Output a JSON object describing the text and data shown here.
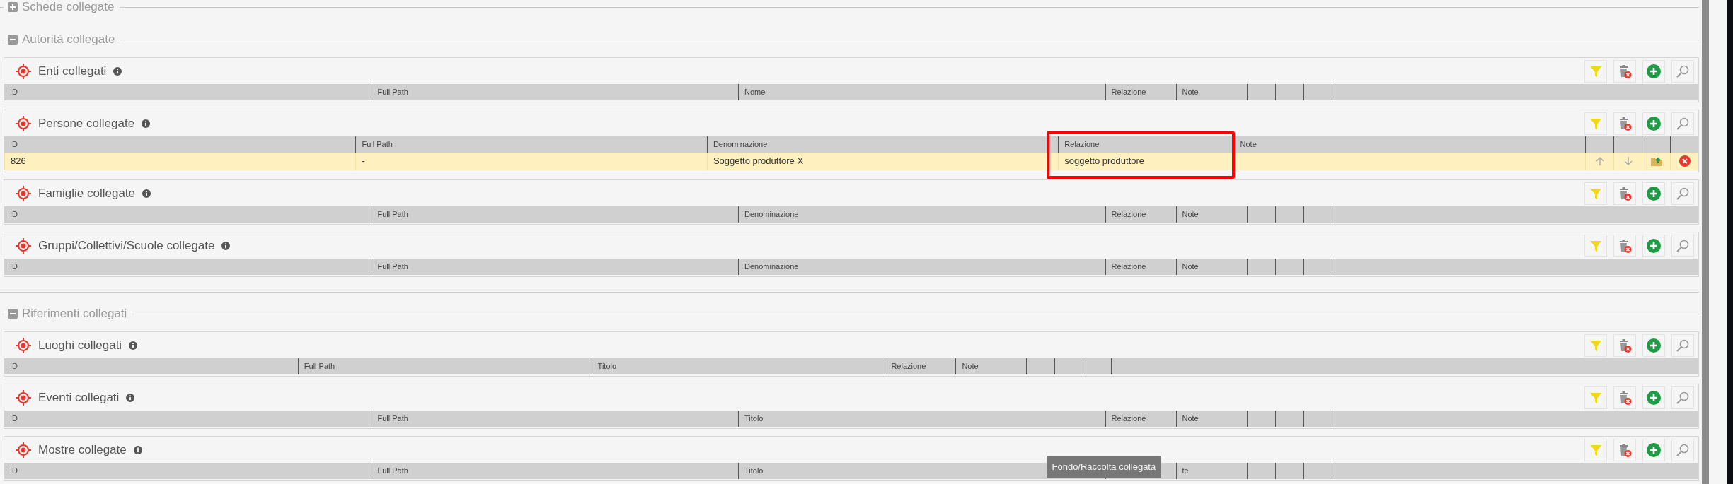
{
  "sections": [
    {
      "title": "Schede collegate",
      "expanded": false
    },
    {
      "title": "Autorità collegate",
      "expanded": true,
      "panels": [
        {
          "title": "Enti collegati",
          "columns": [
            {
              "label": "ID",
              "kind": "wide"
            },
            {
              "label": "Full Path",
              "kind": "wide"
            },
            {
              "label": "Nome",
              "kind": "wide"
            },
            {
              "label": "Relazione",
              "kind": "short"
            },
            {
              "label": "Note",
              "kind": "short"
            },
            {
              "kind": "action"
            },
            {
              "kind": "action"
            },
            {
              "kind": "action"
            },
            {
              "kind": "filler"
            }
          ]
        },
        {
          "title": "Persone collegate",
          "columns": [
            {
              "label": "ID",
              "kind": "wide"
            },
            {
              "label": "Full Path",
              "kind": "wide"
            },
            {
              "label": "Denominazione",
              "kind": "wide"
            },
            {
              "label": "Relazione",
              "kind": "medium",
              "highlighted": true
            },
            {
              "label": "Note",
              "kind": "wide"
            },
            {
              "kind": "action"
            },
            {
              "kind": "action"
            },
            {
              "kind": "action"
            },
            {
              "kind": "action"
            }
          ],
          "rows": [
            {
              "selected": true,
              "cells": [
                "826",
                "-",
                "Soggetto produttore X",
                "soggetto produttore"
              ]
            }
          ]
        },
        {
          "title": "Famiglie collegate",
          "columns": [
            {
              "label": "ID",
              "kind": "wide"
            },
            {
              "label": "Full Path",
              "kind": "wide"
            },
            {
              "label": "Denominazione",
              "kind": "wide"
            },
            {
              "label": "Relazione",
              "kind": "short"
            },
            {
              "label": "Note",
              "kind": "short"
            },
            {
              "kind": "action"
            },
            {
              "kind": "action"
            },
            {
              "kind": "action"
            },
            {
              "kind": "filler"
            }
          ]
        },
        {
          "title": "Gruppi/Collettivi/Scuole collegate",
          "columns": [
            {
              "label": "ID",
              "kind": "wide"
            },
            {
              "label": "Full Path",
              "kind": "wide"
            },
            {
              "label": "Denominazione",
              "kind": "wide"
            },
            {
              "label": "Relazione",
              "kind": "short"
            },
            {
              "label": "Note",
              "kind": "short"
            },
            {
              "kind": "action"
            },
            {
              "kind": "action"
            },
            {
              "kind": "action"
            },
            {
              "kind": "filler"
            }
          ]
        }
      ]
    },
    {
      "title": "Riferimenti collegati",
      "expanded": true,
      "panels": [
        {
          "title": "Luoghi collegati",
          "columns": [
            {
              "label": "ID",
              "kind": "medium"
            },
            {
              "label": "Full Path",
              "kind": "medium"
            },
            {
              "label": "Titolo",
              "kind": "medium"
            },
            {
              "label": "Relazione",
              "kind": "short"
            },
            {
              "label": "Note",
              "kind": "short"
            },
            {
              "kind": "action"
            },
            {
              "kind": "action"
            },
            {
              "kind": "action"
            },
            {
              "kind": "filler"
            }
          ]
        },
        {
          "title": "Eventi collegati",
          "columns": [
            {
              "label": "ID",
              "kind": "wide"
            },
            {
              "label": "Full Path",
              "kind": "wide"
            },
            {
              "label": "Titolo",
              "kind": "wide"
            },
            {
              "label": "Relazione",
              "kind": "short"
            },
            {
              "label": "Note",
              "kind": "short"
            },
            {
              "kind": "action"
            },
            {
              "kind": "action"
            },
            {
              "kind": "action"
            },
            {
              "kind": "filler"
            }
          ]
        },
        {
          "title": "Mostre collegate",
          "columns": [
            {
              "label": "ID",
              "kind": "wide"
            },
            {
              "label": "Full Path",
              "kind": "wide"
            },
            {
              "label": "Titolo",
              "kind": "wide"
            },
            {
              "kind": "short",
              "tooltip": "Fondo/Raccolta collegata"
            },
            {
              "label": "te",
              "kind": "short"
            },
            {
              "kind": "action"
            },
            {
              "kind": "action"
            },
            {
              "kind": "action"
            },
            {
              "kind": "filler"
            }
          ]
        }
      ]
    }
  ]
}
